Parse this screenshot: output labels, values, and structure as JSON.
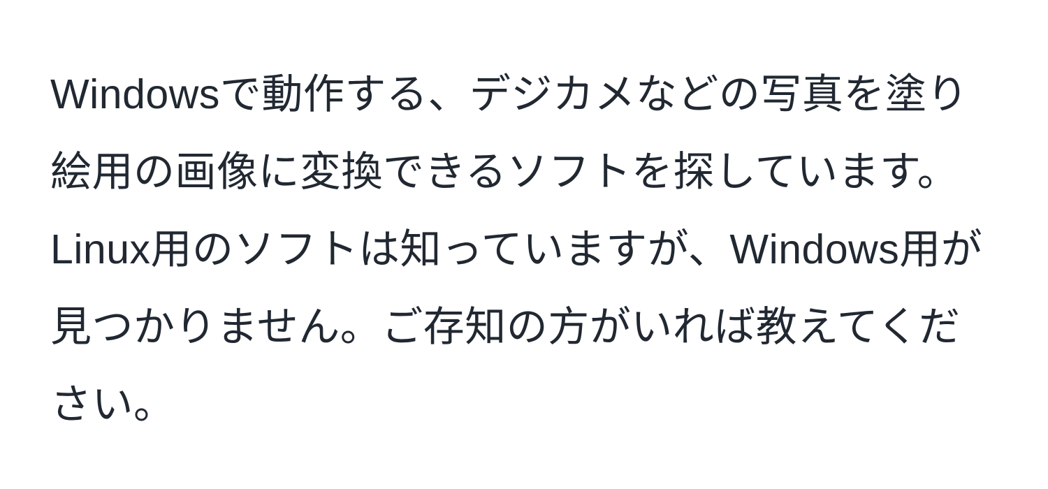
{
  "body": {
    "paragraph": "Windowsで動作する、デジカメなどの写真を塗り絵用の画像に変換できるソフトを探しています。Linux用のソフトは知っていますが、Windows用が見つかりません。ご存知の方がいれば教えてください。"
  }
}
